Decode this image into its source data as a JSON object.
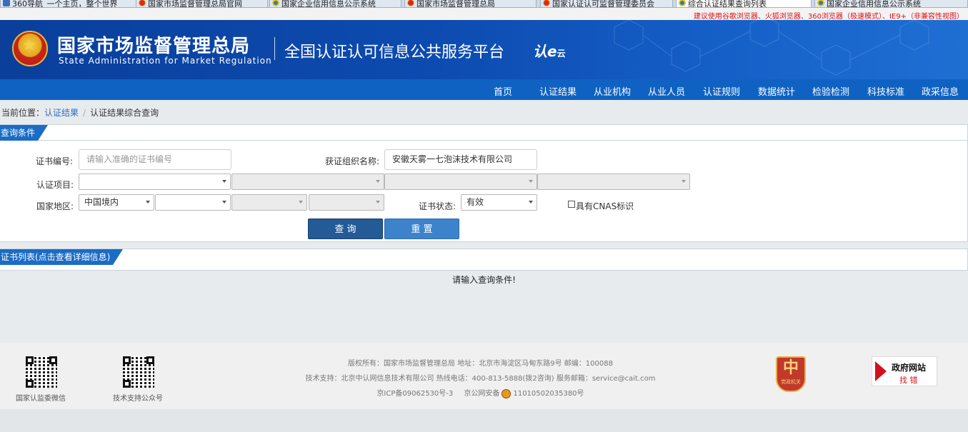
{
  "browser": {
    "tabs": [
      {
        "label": "360导航_一个主页，整个世界",
        "icon": "sq-icon"
      },
      {
        "label": "国家市场监督管理总局官网_",
        "icon": "emblem-icon"
      },
      {
        "label": "国家企业信用信息公示系统",
        "icon": "ie-icon"
      },
      {
        "label": "国家市场监督管理总局",
        "icon": "emblem-icon"
      },
      {
        "label": "国家认证认可监督管理委员会",
        "icon": "emblem-icon"
      },
      {
        "label": "综合认证结果查询列表",
        "icon": "ie-icon",
        "active": true
      },
      {
        "label": "国家企业信用信息公示系统",
        "icon": "ie-icon"
      }
    ]
  },
  "notice": "建议使用谷歌浏览器、火狐浏览器、360浏览器（极速模式）、IE9+（非兼容性视图）",
  "header": {
    "org_cn": "国家市场监督管理总局",
    "org_en": "State Administration  for  Market Regulation",
    "platform": "全国认证认可信息公共服务平台",
    "logo_main": "认e",
    "logo_sub": "云"
  },
  "nav": [
    "首页",
    "认证结果",
    "从业机构",
    "从业人员",
    "认证规则",
    "数据统计",
    "检验检测",
    "科技标准",
    "政采信息"
  ],
  "breadcrumb": {
    "prefix": "当前位置：",
    "link": "认证结果",
    "current": "认证结果综合查询"
  },
  "query_panel": {
    "title": "查询条件",
    "cert_no_label": "证书编号:",
    "cert_no_placeholder": "请输入准确的证书编号",
    "org_name_label": "获证组织名称:",
    "org_name_value": "安徽天雾一七泡沫技术有限公司",
    "project_label": "认证项目:",
    "region_label": "国家地区:",
    "region_value": "中国境内",
    "status_label": "证书状态:",
    "status_value": "有效",
    "cnas_label": "具有CNAS标识",
    "query_button": "查 询",
    "reset_button": "重 置"
  },
  "list_panel": {
    "title": "证书列表(点击查看详细信息)"
  },
  "message": "请输入查询条件!",
  "footer": {
    "qr1_caption": "国家认监委微信",
    "qr2_caption": "技术支持公众号",
    "line1": "版权所有：国家市场监督管理总局    地址：北京市海淀区马甸东路9号    邮编：100088",
    "line2": "技术支持：北京中认网信息技术有限公司    热线电话：400-813-5888(拨2咨询)    服务邮箱：service@cait.com",
    "icp": "京ICP备09062530号-3",
    "police_prefix": "京公网安备",
    "police_no": "11010502035380号",
    "dangzheng": "党政机关",
    "zfwz_title": "政府网站",
    "zfwz_sub": "找 错"
  },
  "colors": {
    "header_blue": "#0d4bb0",
    "nav_blue": "#0f62c2",
    "panel_title": "#1a6cc6",
    "query_btn": "#245a95",
    "reset_btn": "#3d83cc"
  }
}
